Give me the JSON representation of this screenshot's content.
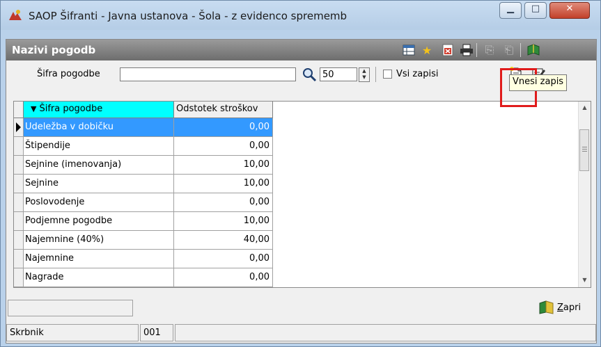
{
  "window": {
    "title": "SAOP Šifranti - Javna ustanova - Šola - z evidenco sprememb",
    "controls": {
      "minimize": "▁",
      "maximize": "□",
      "close": "✕"
    }
  },
  "header": {
    "title": "Nazivi pogodb",
    "icons": [
      "grid-settings-icon",
      "favorite-star-icon",
      "excel-export-icon",
      "printer-icon",
      "copy-disabled-icon",
      "paste-disabled-icon",
      "book-exit-icon"
    ]
  },
  "search": {
    "label": "Šifra pogodbe",
    "value": "",
    "count": "50",
    "all_records_label": "Vsi zapisi",
    "all_records_checked": false
  },
  "toolbar": {
    "new_record_tooltip": "Vnesi zapis"
  },
  "table": {
    "columns": [
      "Šifra pogodbe",
      "Odstotek stroškov"
    ],
    "sort_indicator": "▼",
    "rows": [
      {
        "name": "Udeležba v dobičku",
        "percent": "0,00",
        "selected": true
      },
      {
        "name": "Štipendije",
        "percent": "0,00"
      },
      {
        "name": "Sejnine (imenovanja)",
        "percent": "10,00"
      },
      {
        "name": "Sejnine",
        "percent": "10,00"
      },
      {
        "name": "Poslovodenje",
        "percent": "0,00"
      },
      {
        "name": "Podjemne pogodbe",
        "percent": "10,00"
      },
      {
        "name": "Najemnine (40%)",
        "percent": "40,00"
      },
      {
        "name": "Najemnine",
        "percent": "0,00"
      },
      {
        "name": "Nagrade",
        "percent": "0,00"
      }
    ]
  },
  "footer": {
    "close_label": "Zapri",
    "close_accel": "Z",
    "close_rest": "apri"
  },
  "status": {
    "label": "Skrbnik",
    "code": "001"
  },
  "colors": {
    "selection": "#3399ff",
    "sort_header": "#00ffff",
    "highlight_box": "#e01b1b",
    "tooltip_bg": "#ffffe1"
  }
}
